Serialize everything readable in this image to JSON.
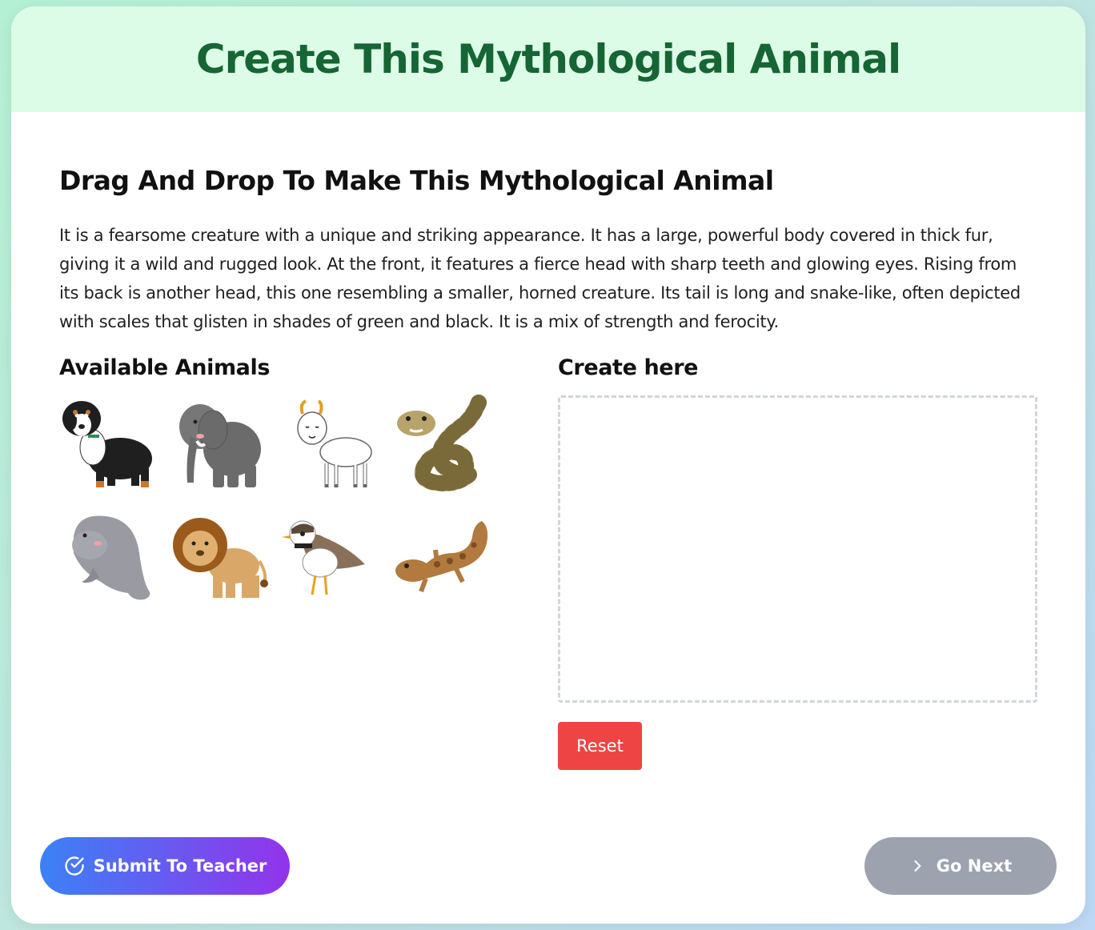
{
  "header": {
    "title": "Create This Mythological Animal"
  },
  "activity": {
    "subtitle": "Drag And Drop To Make This Mythological Animal",
    "description": "It is a fearsome creature with a unique and striking appearance. It has a large, powerful body covered in thick fur, giving it a wild and rugged look. At the front, it features a fierce head with sharp teeth and glowing eyes. Rising from its back is another head, this one resembling a smaller, horned creature. Its tail is long and snake-like, often depicted with scales that glisten in shades of green and black. It is a mix of strength and ferocity."
  },
  "available": {
    "title": "Available Animals",
    "animals": [
      {
        "icon": "dog-icon"
      },
      {
        "icon": "elephant-icon"
      },
      {
        "icon": "goat-icon"
      },
      {
        "icon": "snake-icon"
      },
      {
        "icon": "manatee-icon"
      },
      {
        "icon": "lion-icon"
      },
      {
        "icon": "bird-icon"
      },
      {
        "icon": "gecko-icon"
      }
    ]
  },
  "create": {
    "title": "Create here",
    "reset_label": "Reset"
  },
  "footer": {
    "submit_label": "Submit To Teacher",
    "next_label": "Go Next",
    "submit_icon": "check-circle-icon",
    "next_icon": "chevron-right-icon"
  },
  "colors": {
    "header_bg": "#dcfce7",
    "title": "#166534",
    "reset": "#ef4444",
    "submit_from": "#3b82f6",
    "submit_to": "#9333ea",
    "next": "#9ca3af"
  }
}
